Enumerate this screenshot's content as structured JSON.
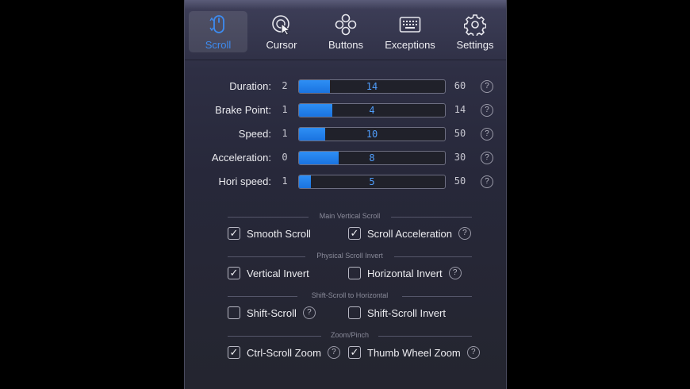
{
  "tabs": [
    {
      "label": "Scroll",
      "icon": "scroll-icon",
      "active": true
    },
    {
      "label": "Cursor",
      "icon": "cursor-icon",
      "active": false
    },
    {
      "label": "Buttons",
      "icon": "buttons-icon",
      "active": false
    },
    {
      "label": "Exceptions",
      "icon": "keyboard-icon",
      "active": false
    },
    {
      "label": "Settings",
      "icon": "gear-icon",
      "active": false
    }
  ],
  "sliders": [
    {
      "label": "Duration:",
      "min": "2",
      "max": "60",
      "value": "14",
      "fraction": 0.21
    },
    {
      "label": "Brake Point:",
      "min": "1",
      "max": "14",
      "value": "4",
      "fraction": 0.23
    },
    {
      "label": "Speed:",
      "min": "1",
      "max": "50",
      "value": "10",
      "fraction": 0.18
    },
    {
      "label": "Acceleration:",
      "min": "0",
      "max": "30",
      "value": "8",
      "fraction": 0.27
    },
    {
      "label": "Hori speed:",
      "min": "1",
      "max": "50",
      "value": "5",
      "fraction": 0.08
    }
  ],
  "help_glyph": "?",
  "sections": [
    {
      "title": "Main Vertical Scroll",
      "options": [
        {
          "label": "Smooth Scroll",
          "checked": true,
          "help": false
        },
        {
          "label": "Scroll Acceleration",
          "checked": true,
          "help": true
        }
      ]
    },
    {
      "title": "Physical Scroll Invert",
      "options": [
        {
          "label": "Vertical Invert",
          "checked": true,
          "help": false
        },
        {
          "label": "Horizontal Invert",
          "checked": false,
          "help": true
        }
      ]
    },
    {
      "title": "Shift-Scroll to Horizontal",
      "options": [
        {
          "label": "Shift-Scroll",
          "checked": false,
          "help": true
        },
        {
          "label": "Shift-Scroll Invert",
          "checked": false,
          "help": false
        }
      ]
    },
    {
      "title": "Zoom/Pinch",
      "options": [
        {
          "label": "Ctrl-Scroll Zoom",
          "checked": true,
          "help": true
        },
        {
          "label": "Thumb Wheel Zoom",
          "checked": true,
          "help": true
        }
      ]
    }
  ],
  "colors": {
    "accent": "#2a87f2",
    "active_label": "#3d8bf0"
  }
}
